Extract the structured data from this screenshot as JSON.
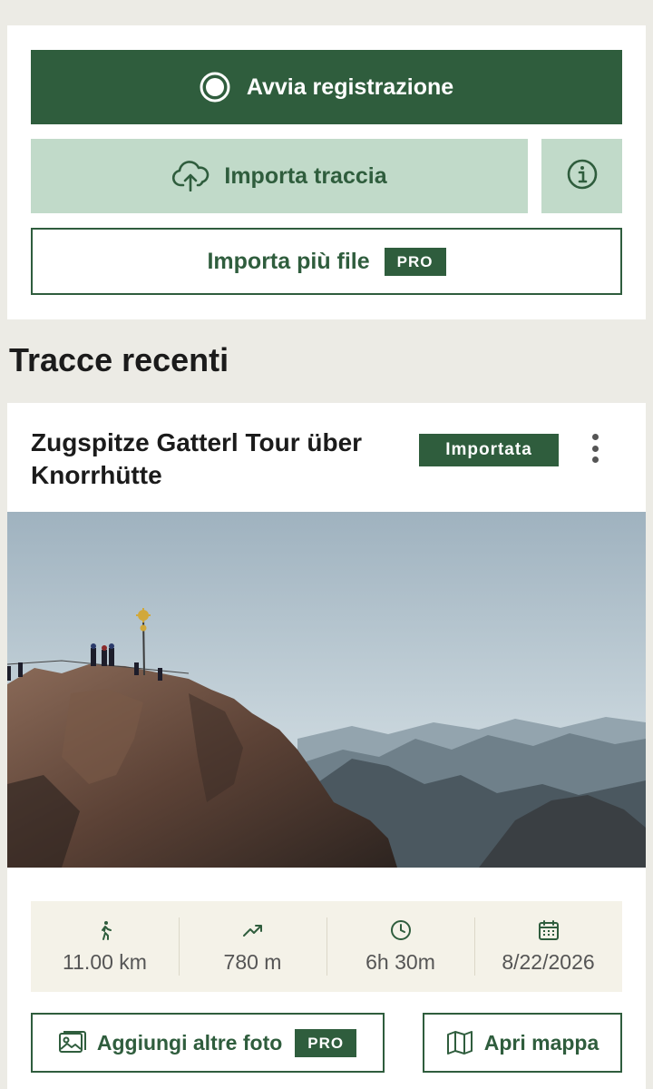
{
  "actions": {
    "record_label": "Avvia registrazione",
    "import_label": "Importa traccia",
    "import_multiple_label": "Importa più file",
    "pro_badge": "PRO"
  },
  "recent": {
    "title": "Tracce recenti"
  },
  "track": {
    "title": "Zugspitze Gatterl Tour über Knorrhütte",
    "status_badge": "Importata",
    "stats": {
      "distance": "11.00 km",
      "elevation": "780 m",
      "duration": "6h 30m",
      "date": "8/22/2026"
    },
    "add_photos_label": "Aggiungi altre foto",
    "add_photos_pro": "PRO",
    "open_map_label": "Apri mappa"
  },
  "colors": {
    "brand_green": "#2f5d3d",
    "light_green": "#c1dac9",
    "stats_bg": "#f4f2e8",
    "page_bg": "#ecebe5"
  },
  "icons": [
    "record-icon",
    "cloud-upload-icon",
    "info-icon",
    "more-vertical-icon",
    "walk-icon",
    "trending-up-icon",
    "clock-icon",
    "calendar-icon",
    "image-icon",
    "map-icon"
  ]
}
